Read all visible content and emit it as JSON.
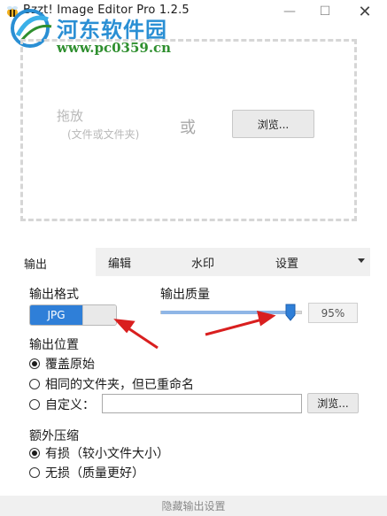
{
  "window": {
    "title": "Bzzt! Image Editor Pro 1.2.5",
    "controls": {
      "minimize": "—",
      "maximize": "☐",
      "close": "✕"
    }
  },
  "watermark": {
    "site_name": "河东软件园",
    "url": "www.pc0359.cn"
  },
  "dropzone": {
    "drag_label": "拖放",
    "drag_hint": "(文件或文件夹)",
    "or_label": "或",
    "browse_label": "浏览..."
  },
  "tabs": {
    "items": [
      {
        "label": "输出",
        "active": true
      },
      {
        "label": "编辑",
        "active": false
      },
      {
        "label": "水印",
        "active": false
      },
      {
        "label": "设置",
        "active": false
      }
    ]
  },
  "output": {
    "format_heading": "输出格式",
    "format_selected": "JPG",
    "quality_heading": "输出质量",
    "quality_value": "95%",
    "quality_fraction": 0.95,
    "location_heading": "输出位置",
    "location_options": [
      {
        "label": "覆盖原始",
        "checked": true
      },
      {
        "label": "相同的文件夹，但已重命名",
        "checked": false
      },
      {
        "label": "自定义：",
        "checked": false
      }
    ],
    "custom_path_value": "",
    "custom_browse_label": "浏览...",
    "compression_heading": "额外压缩",
    "compression_options": [
      {
        "label": "有损（较小文件大小）",
        "checked": true
      },
      {
        "label": "无损（质量更好）",
        "checked": false
      }
    ]
  },
  "footer": {
    "collapse_label": "隐藏输出设置"
  },
  "colors": {
    "accent": "#2f7fd8",
    "annotation_arrow": "#d91f1f",
    "watermark_blue": "#2a8fd4",
    "watermark_green": "#2f8f2f"
  }
}
